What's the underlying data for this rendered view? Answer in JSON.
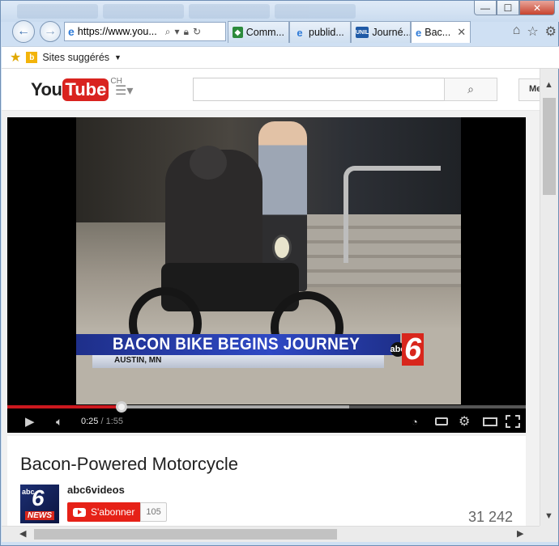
{
  "browser": {
    "window_buttons": {
      "minimize": "—",
      "maximize": "☐",
      "close": "✕"
    },
    "address": {
      "url": "https://www.you...",
      "search_icon": "search-icon",
      "lock_icon": "lock-icon",
      "refresh_icon": "refresh-icon"
    },
    "tabs": [
      {
        "label": "Comm...",
        "icon": "shield"
      },
      {
        "label": "publid...",
        "icon": "ie"
      },
      {
        "label": "Journé...",
        "icon": "unil",
        "icon_text": "UNIL"
      },
      {
        "label": "Bac...",
        "icon": "ie",
        "active": true
      }
    ],
    "favorites": {
      "suggested_sites": "Sites suggérés"
    }
  },
  "youtube": {
    "logo_you": "You",
    "logo_tube": "Tube",
    "country": "CH",
    "search_placeholder": "",
    "signin_label": "Me",
    "video": {
      "overlay_title": "BACON BIKE BEGINS JOURNEY",
      "overlay_location": "AUSTIN, MN",
      "station_abc": "abc",
      "station_num": "6",
      "current_time": "0:25",
      "separator": "/",
      "duration": "1:55",
      "progress_played": 0.22,
      "progress_loaded": 0.66
    },
    "title": "Bacon-Powered Motorcycle",
    "channel": {
      "name": "abc6videos",
      "avatar_abc": "abc",
      "avatar_num": "6",
      "avatar_news": "NEWS",
      "subscribe_label": "S'abonner",
      "subscriber_count": "105"
    },
    "views": "31 242"
  },
  "colors": {
    "youtube_red": "#e62117",
    "progress_red": "#cc181e",
    "news_blue": "#2f49c4"
  }
}
